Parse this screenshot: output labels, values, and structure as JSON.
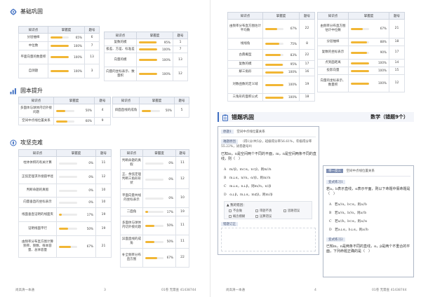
{
  "colors": {
    "accent": "#f1b634",
    "header_bg": "#eef1f7",
    "icon": "#3f6fc2",
    "ribbon": "#c9d6ec"
  },
  "left": {
    "basic": {
      "title": "基础巩固",
      "icon": "gear-icon",
      "headers": [
        "知识点",
        "掌握度",
        "题号"
      ],
      "table_a": [
        {
          "name": "分层抽样",
          "pct": 65,
          "label": "65%",
          "no": "6"
        },
        {
          "name": "中位数",
          "pct": 100,
          "label": "100%",
          "no": "7"
        },
        {
          "name": "平面向量的数量积",
          "pct": 100,
          "label": "100%",
          "no": "13"
        },
        {
          "name": "自测题",
          "pct": 100,
          "label": "100%",
          "no": "3"
        }
      ],
      "table_b": [
        {
          "name": "复数的模",
          "pct": 95,
          "label": "95%",
          "no": "1"
        },
        {
          "name": "极差、方差、标准差",
          "pct": 100,
          "label": "100%",
          "no": "7"
        },
        {
          "name": "向量的模",
          "pct": 100,
          "label": "100%",
          "no": "13"
        },
        {
          "name": "向量的坐标表示、数量积",
          "pct": 100,
          "label": "100%",
          "no": "12"
        }
      ]
    },
    "improve": {
      "title": "固本提升",
      "icon": "bar-chart-icon",
      "headers": [
        "知识点",
        "掌握度",
        "题号"
      ],
      "table_a": [
        {
          "name": "多面体与球体内切外接问题",
          "pct": 50,
          "label": "50%",
          "no": "4"
        },
        {
          "name": "空间中点线位置关系",
          "pct": 60,
          "label": "60%",
          "no": "9"
        }
      ],
      "table_b": [
        {
          "name": "斜面直线的成角",
          "pct": 50,
          "label": "50%",
          "no": "5"
        }
      ]
    },
    "hard": {
      "title": "攻坚克难",
      "icon": "compass-icon",
      "headers": [
        "知识点",
        "掌握度",
        "题号"
      ],
      "table_a": [
        {
          "name": "柱体体积的有关计算",
          "pct": 0,
          "label": "0%",
          "no": "11"
        },
        {
          "name": "正弦定理求外接圆半径",
          "pct": 0,
          "label": "0%",
          "no": "12"
        },
        {
          "name": "判断命题的真假",
          "pct": 0,
          "label": "0%",
          "no": "10"
        },
        {
          "name": "向量垂直的坐标表示",
          "pct": 0,
          "label": "0%",
          "no": "10"
        },
        {
          "name": "线面垂直证明的线面夹",
          "pct": 17,
          "label": "17%",
          "no": "19"
        },
        {
          "name": "证明线面平行",
          "pct": 50,
          "label": "50%",
          "no": "19"
        },
        {
          "name": "由频率分布直方图计算频率、频数、样本容量、总体容量",
          "pct": 67,
          "label": "67%",
          "no": "21"
        }
      ],
      "table_b": [
        {
          "name": "判断命题的真假",
          "pct": 0,
          "label": "0%",
          "no": "11"
        },
        {
          "name": "正、余弦定理判断三角形形状",
          "pct": 0,
          "label": "0%",
          "no": "12"
        },
        {
          "name": "平面向量共线的坐标表示",
          "pct": 0,
          "label": "0%",
          "no": "10"
        },
        {
          "name": "二面角",
          "pct": 17,
          "label": "17%",
          "no": "19"
        },
        {
          "name": "多面体与球体内切外接问题",
          "pct": 50,
          "label": "50%",
          "no": "11"
        },
        {
          "name": "异面直线的成角",
          "pct": 50,
          "label": "50%",
          "no": "11"
        },
        {
          "name": "补全频率分布直方图",
          "pct": 67,
          "label": "67%",
          "no": "22"
        }
      ]
    },
    "footer": {
      "left": "尚高清一本通",
      "page": "3",
      "right": "01卷 无需查  41438744"
    }
  },
  "right": {
    "top": {
      "headers": [
        "知识点",
        "掌握度",
        "题号"
      ],
      "table_a": [
        {
          "name": "由频率分布直方图估计平均数",
          "pct": 67,
          "label": "67%",
          "no": "22"
        },
        {
          "name": "线线角",
          "pct": 75,
          "label": "75%",
          "no": "8"
        },
        {
          "name": "古典概型",
          "pct": 83,
          "label": "83%",
          "no": "22"
        },
        {
          "name": "复数的模",
          "pct": 95,
          "label": "95%",
          "no": "17"
        },
        {
          "name": "解三角形",
          "pct": 100,
          "label": "100%",
          "no": "16"
        },
        {
          "name": "对数函数的定义域",
          "pct": 100,
          "label": "100%",
          "no": "19"
        },
        {
          "name": "三角形的面积公式",
          "pct": 100,
          "label": "100%",
          "no": "18"
        }
      ],
      "table_b": [
        {
          "name": "由频率分布直方图估计中位数",
          "pct": 67,
          "label": "67%",
          "no": "21"
        },
        {
          "name": "分层抽样",
          "pct": 88,
          "label": "88%",
          "no": "18"
        },
        {
          "name": "复数的坐标表示",
          "pct": 90,
          "label": "90%",
          "no": "17"
        },
        {
          "name": "点到面距离",
          "pct": 100,
          "label": "100%",
          "no": "14"
        },
        {
          "name": "投影向量",
          "pct": 100,
          "label": "100%",
          "no": "15"
        },
        {
          "name": "向量的坐标表示、数量积",
          "pct": 100,
          "label": "100%",
          "no": "12"
        }
      ]
    },
    "wrong": {
      "title": "错题巩固",
      "subtitle": "数学（错题9个）",
      "icon": "clipboard-icon",
      "q1": {
        "tag": "原题1",
        "topic": "空间中点线位置关系",
        "meta_label": "难题原因",
        "meta": "（得1分/共5分，班级得分率56.61%，年级得分率55.22%，试卷题号9）",
        "stem": "已知m，n是空间两个不同的平面，m，n是空间两条不同的直线，则（　）",
        "options": [
          "A　m//β，m⊂α，n⊂β，则m//n",
          "B　m⊥α，n//α，α//β，则m//n",
          "C　m⊥α，n⊥β，则m//n，n//β",
          "D　α⊥β，m⊥α，m⊄β，则m//β"
        ],
        "reason_label": "▲ 我的错因：",
        "reasons": [
          "不会做",
          "审题不清",
          "思路错误",
          "概念模糊",
          "运算错误"
        ],
        "notes_label": "错题订正"
      },
      "q2": {
        "tag": "举一反三",
        "topic": "空间中点线位置关系",
        "sub_tag": "变式练习1",
        "stem": "若a，b表示直线，α表示平面，则以下命题中假命题是（　）",
        "options": [
          "A　若a//α，b⊂α，则a//b",
          "B　若a//α，b//α，则a//b",
          "C　若a//b，b⊂α，则a//α",
          "D　若a⊥α，b⊥α，则a//b"
        ],
        "sub_tag2": "变式练习2",
        "stem2": "已知m，n是两条不同的直线，α，β是两个不重合的平面，下列命题正确的是（　）"
      }
    },
    "footer": {
      "left": "尚高清一本通",
      "page": "4",
      "right": "01卷 无需查  41438744"
    }
  }
}
